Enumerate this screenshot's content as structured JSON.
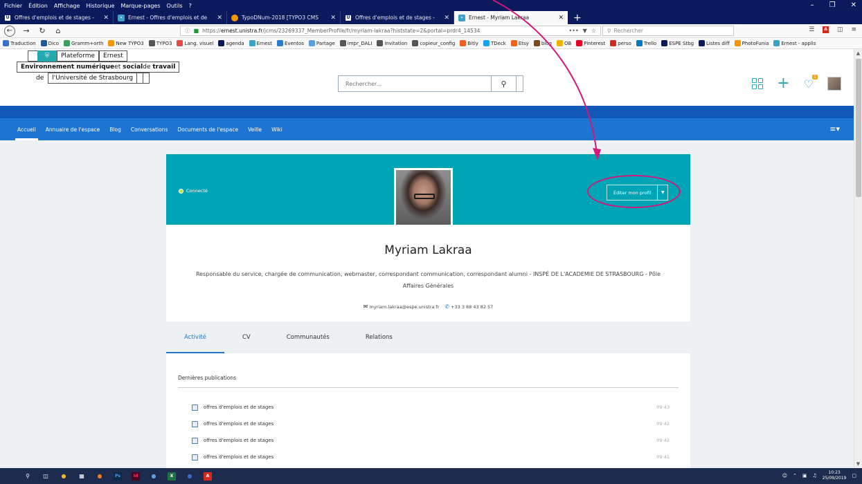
{
  "menubar": [
    "Fichier",
    "Édition",
    "Affichage",
    "Historique",
    "Marque-pages",
    "Outils",
    "?"
  ],
  "tabs": [
    {
      "label": "Offres d'emplois et de stages -",
      "icon": "u"
    },
    {
      "label": "Ernest - Offres d'emplois et de",
      "icon": "e"
    },
    {
      "label": "TypoDNum-2018 [TYPO3 CMS",
      "icon": "t"
    },
    {
      "label": "Offres d'emplois et de stages -",
      "icon": "u"
    },
    {
      "label": "Ernest - Myriam Lakraa",
      "icon": "e",
      "active": true
    }
  ],
  "urlbar": {
    "url_prefix": "https://",
    "url_domain": "ernest.unistra.fr",
    "url_rest": "/jcms/23269337_MemberProfile/fr/myriam-lakraa?histstate=2&portal=prdr4_14534",
    "search_placeholder": "Rechercher",
    "dots": "•••"
  },
  "bookmarks": [
    {
      "label": "Traduction",
      "color": "#3a6ec8"
    },
    {
      "label": "Dico",
      "color": "#1d57a8"
    },
    {
      "label": "Gramm+orth",
      "color": "#3aa05c"
    },
    {
      "label": "New TYPO3",
      "color": "#f49700"
    },
    {
      "label": "TYPO3",
      "color": "#555"
    },
    {
      "label": "Lang. visuel",
      "color": "#e34b4b"
    },
    {
      "label": "agenda",
      "color": "#0a1a5c"
    },
    {
      "label": "Ernest",
      "color": "#3ba3c7"
    },
    {
      "label": "Eventos",
      "color": "#2b7bd1"
    },
    {
      "label": "Partage",
      "color": "#5aa0e0"
    },
    {
      "label": "impr_DALI",
      "color": "#555"
    },
    {
      "label": "invitation",
      "color": "#555"
    },
    {
      "label": "copieur_config",
      "color": "#555"
    },
    {
      "label": "Bitly",
      "color": "#ee6123"
    },
    {
      "label": "TDeck",
      "color": "#1da1f2"
    },
    {
      "label": "Etsy",
      "color": "#f1641e"
    },
    {
      "label": "blog",
      "color": "#7a4b1e"
    },
    {
      "label": "OB",
      "color": "#f0b400"
    },
    {
      "label": "Pinterest",
      "color": "#e60023"
    },
    {
      "label": "perso",
      "color": "#d42b1e"
    },
    {
      "label": "Trello",
      "color": "#0079bf"
    },
    {
      "label": "ESPE Stbg",
      "color": "#0a1a5c"
    },
    {
      "label": "Listes diff",
      "color": "#0a1a5c"
    },
    {
      "label": "PhotoFunia",
      "color": "#f49700"
    },
    {
      "label": "Ernest - applis",
      "color": "#3ba3c7"
    }
  ],
  "logo": {
    "platform": "Plateforme",
    "name": "Ernest",
    "line2_a": "Environnement numérique",
    "line2_b": " et ",
    "line2_c": "social",
    "line2_d": " de ",
    "line2_e": "travail",
    "line3_de": "de",
    "line3_univ": "l'Université de Strasbourg"
  },
  "site_search": {
    "placeholder": "Rechercher..."
  },
  "header": {
    "badge": "1"
  },
  "nav": [
    "Accueil",
    "Annuaire de l'espace",
    "Blog",
    "Conversations",
    "Documents de l'espace",
    "Veille",
    "Wiki"
  ],
  "profile": {
    "status": "Connecté",
    "edit_label": "Éditer mon profil",
    "name": "Myriam Lakraa",
    "role": "Responsable du service, chargée de communication, webmaster, correspondant communication, correspondant alumni - INSPÉ DE L'ACADEMIE DE STRASBOURG - Pôle Affaires Générales",
    "email": "myriam.lakraa@espe.unistra.fr",
    "phone": "+33 3 88 43 82 57"
  },
  "profile_tabs": [
    "Activité",
    "CV",
    "Communautés",
    "Relations"
  ],
  "feed": {
    "title": "Dernières publications",
    "items": [
      {
        "title": "offres d'emplois et de stages",
        "time": "09:43"
      },
      {
        "title": "offres d'emplois et de stages",
        "time": "09:42"
      },
      {
        "title": "offres d'emplois et de stages",
        "time": "09:42"
      },
      {
        "title": "offres d'emplois et de stages",
        "time": "09:41"
      }
    ]
  },
  "tray": {
    "time": "10:23",
    "date": "25/09/2019"
  },
  "colors": {
    "teal": "#00a5b5",
    "nav_blue": "#1d74d1",
    "annotation": "#d4177a"
  }
}
